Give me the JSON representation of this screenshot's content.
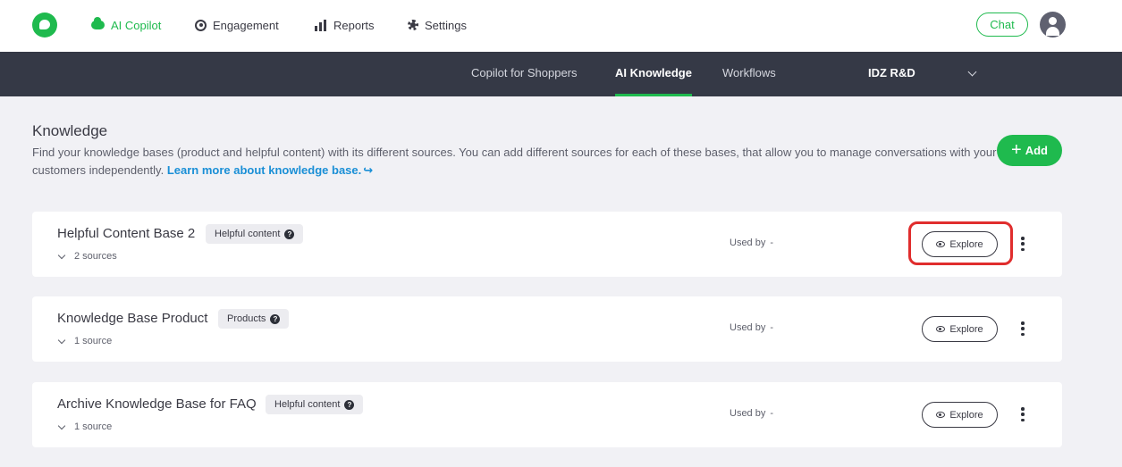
{
  "topnav": {
    "items": [
      {
        "label": "AI Copilot",
        "icon": "cloud-icon"
      },
      {
        "label": "Engagement",
        "icon": "target-icon"
      },
      {
        "label": "Reports",
        "icon": "bar-chart-icon"
      },
      {
        "label": "Settings",
        "icon": "gear-icon"
      }
    ],
    "chat_label": "Chat"
  },
  "subnav": {
    "tabs": [
      {
        "label": "Copilot for Shoppers"
      },
      {
        "label": "AI Knowledge"
      },
      {
        "label": "Workflows"
      }
    ],
    "org": "IDZ R&D",
    "active_tab": "AI Knowledge"
  },
  "header": {
    "title": "Knowledge",
    "description": "Find your knowledge bases (product and helpful content) with its different sources. You can add different sources for each of these bases, that allow you to manage conversations with your customers independently.",
    "learn_more": "Learn more about knowledge base.",
    "add_label": "Add"
  },
  "colors": {
    "accent": "#1fba4e",
    "subnav_bg": "#353946",
    "link": "#1a8fd6",
    "highlight": "#e02d2d"
  },
  "cards": [
    {
      "title": "Helpful Content Base 2",
      "badge": "Helpful content",
      "sources": "2 sources",
      "used_by_label": "Used by",
      "used_by_value": "-",
      "explore_label": "Explore"
    },
    {
      "title": "Knowledge Base Product",
      "badge": "Products",
      "sources": "1 source",
      "used_by_label": "Used by",
      "used_by_value": "-",
      "explore_label": "Explore"
    },
    {
      "title": "Archive Knowledge Base for FAQ",
      "badge": "Helpful content",
      "sources": "1 source",
      "used_by_label": "Used by",
      "used_by_value": "-",
      "explore_label": "Explore"
    }
  ]
}
